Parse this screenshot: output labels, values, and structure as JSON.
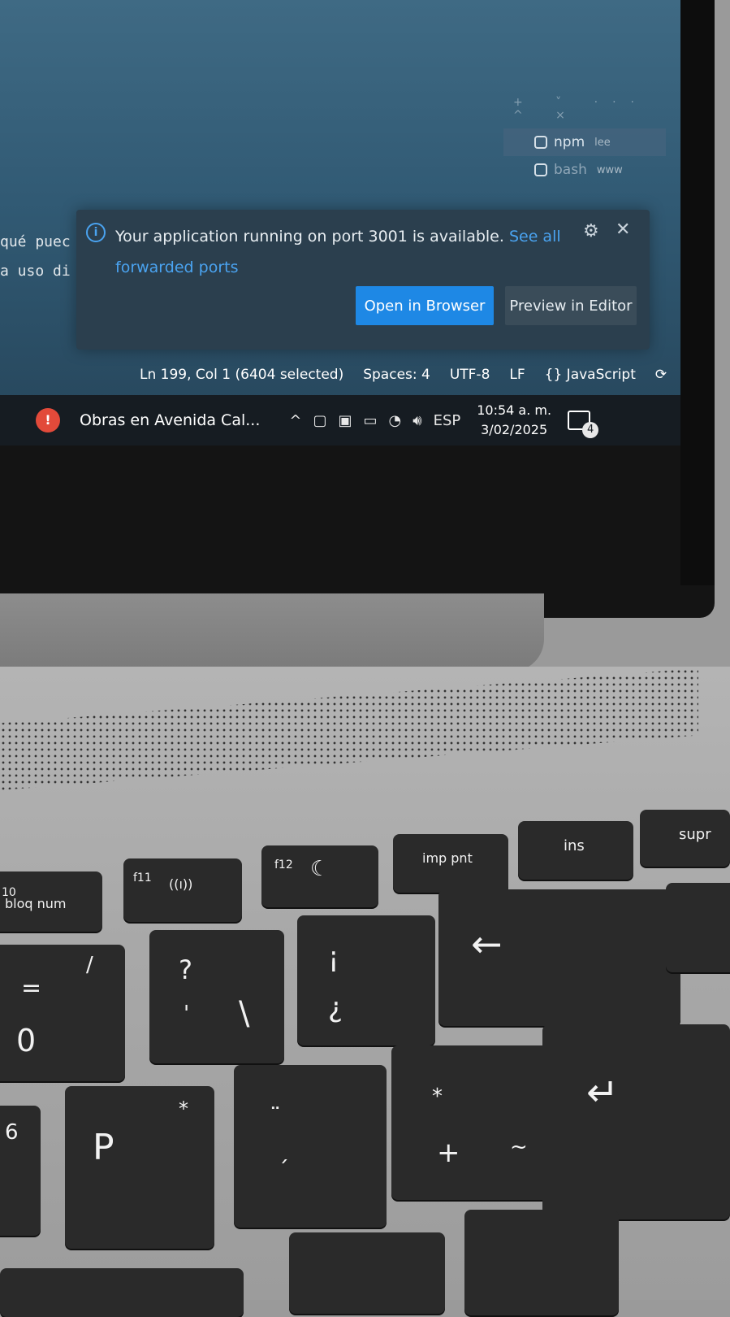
{
  "editor": {
    "line1": "qué puec",
    "line2": "a uso di"
  },
  "terminal_panel": {
    "toolbar": "+ ˅ ··· ^ ×",
    "items": [
      {
        "name": "npm",
        "sub": "lee"
      },
      {
        "name": "bash",
        "sub": "www"
      }
    ]
  },
  "notification": {
    "message": "Your application running on port 3001 is available.",
    "link": "See all forwarded ports",
    "primary_button": "Open in Browser",
    "secondary_button": "Preview in Editor"
  },
  "statusbar": {
    "position": "Ln 199, Col 1 (6404 selected)",
    "spaces": "Spaces: 4",
    "encoding": "UTF-8",
    "eol": "LF",
    "language": "{} JavaScript"
  },
  "taskbar": {
    "news": "Obras en Avenida Cal...",
    "language": "ESP",
    "time": "10:54 a. m.",
    "date": "3/02/2025",
    "notifications": "4"
  },
  "keys": {
    "f10": "10",
    "bloq_num": "bloq num",
    "f11": "f11",
    "f11_icon": "((ı))",
    "f12": "f12",
    "f12_icon": "☾",
    "imp_pnt": "imp pnt",
    "ins": "ins",
    "supr": "supr",
    "zero_top": "=",
    "zero": "0",
    "slash": "/",
    "question": "?",
    "apostrophe": "'",
    "backslash": "\\",
    "inv_excl": "¡",
    "inv_question": "¿",
    "backspace": "←",
    "enter": "↵",
    "six": "6",
    "p": "P",
    "star": "*",
    "umlaut": "¨",
    "acute": "´",
    "plus_star": "*",
    "plus": "+",
    "tilde": "~"
  }
}
